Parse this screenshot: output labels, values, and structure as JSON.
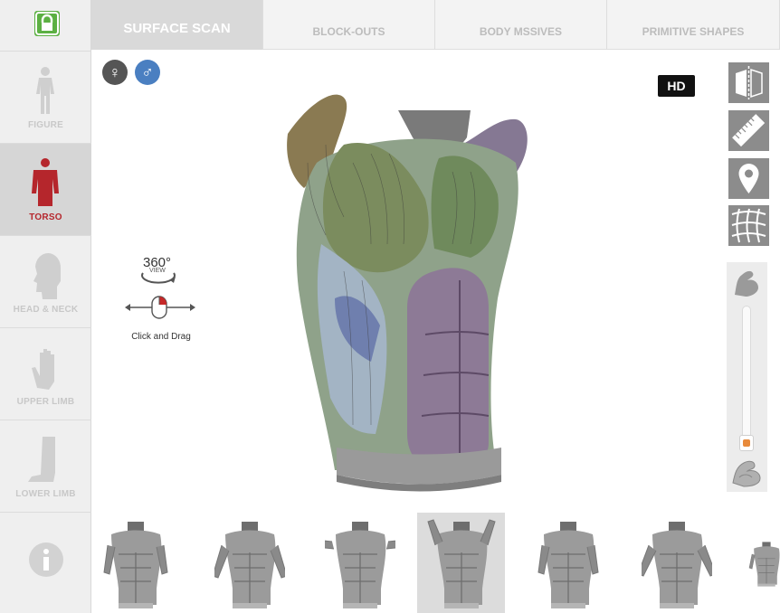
{
  "lock": {
    "icon": "lock-icon",
    "color": "#5cb043"
  },
  "sidebar": {
    "items": [
      {
        "label": "FIGURE",
        "icon": "figure-icon",
        "active": false
      },
      {
        "label": "TORSO",
        "icon": "torso-icon",
        "active": true
      },
      {
        "label": "HEAD & NECK",
        "icon": "head-icon",
        "active": false
      },
      {
        "label": "UPPER LIMB",
        "icon": "hand-icon",
        "active": false
      },
      {
        "label": "LOWER LIMB",
        "icon": "leg-icon",
        "active": false
      }
    ],
    "info_icon": "info-icon"
  },
  "tabs": [
    {
      "label": "SURFACE SCAN",
      "active": true
    },
    {
      "label": "BLOCK-OUTS",
      "active": false
    },
    {
      "label": "BODY MSSIVES",
      "active": false
    },
    {
      "label": "PRIMITIVE SHAPES",
      "active": false
    }
  ],
  "gender": {
    "female_symbol": "♀",
    "male_symbol": "♂",
    "female_color": "#555555",
    "male_color": "#4a7fc1",
    "selected": "male"
  },
  "hd_label": "HD",
  "tools": [
    {
      "icon": "mirror-icon"
    },
    {
      "icon": "ruler-icon"
    },
    {
      "icon": "map-pin-icon"
    },
    {
      "icon": "grid-warp-icon"
    }
  ],
  "muscle_slider": {
    "icon_top": "flex-arm-icon",
    "icon_bottom": "muscle-arm-icon",
    "value_fraction": 0.03,
    "thumb_color": "#e88a3b"
  },
  "rotate_hint": {
    "label": "360°",
    "sub": "VIEW",
    "caption": "Click and Drag"
  },
  "active_sidebar_color": "#b5262c",
  "thumbnails": [
    {
      "pose": "arms-down",
      "active": false
    },
    {
      "pose": "arms-out",
      "active": false
    },
    {
      "pose": "arms-horizontal",
      "active": false
    },
    {
      "pose": "arms-raised",
      "active": true
    },
    {
      "pose": "arms-down-2",
      "active": false
    },
    {
      "pose": "arms-out-2",
      "active": false
    },
    {
      "pose": "partial",
      "active": false
    }
  ]
}
